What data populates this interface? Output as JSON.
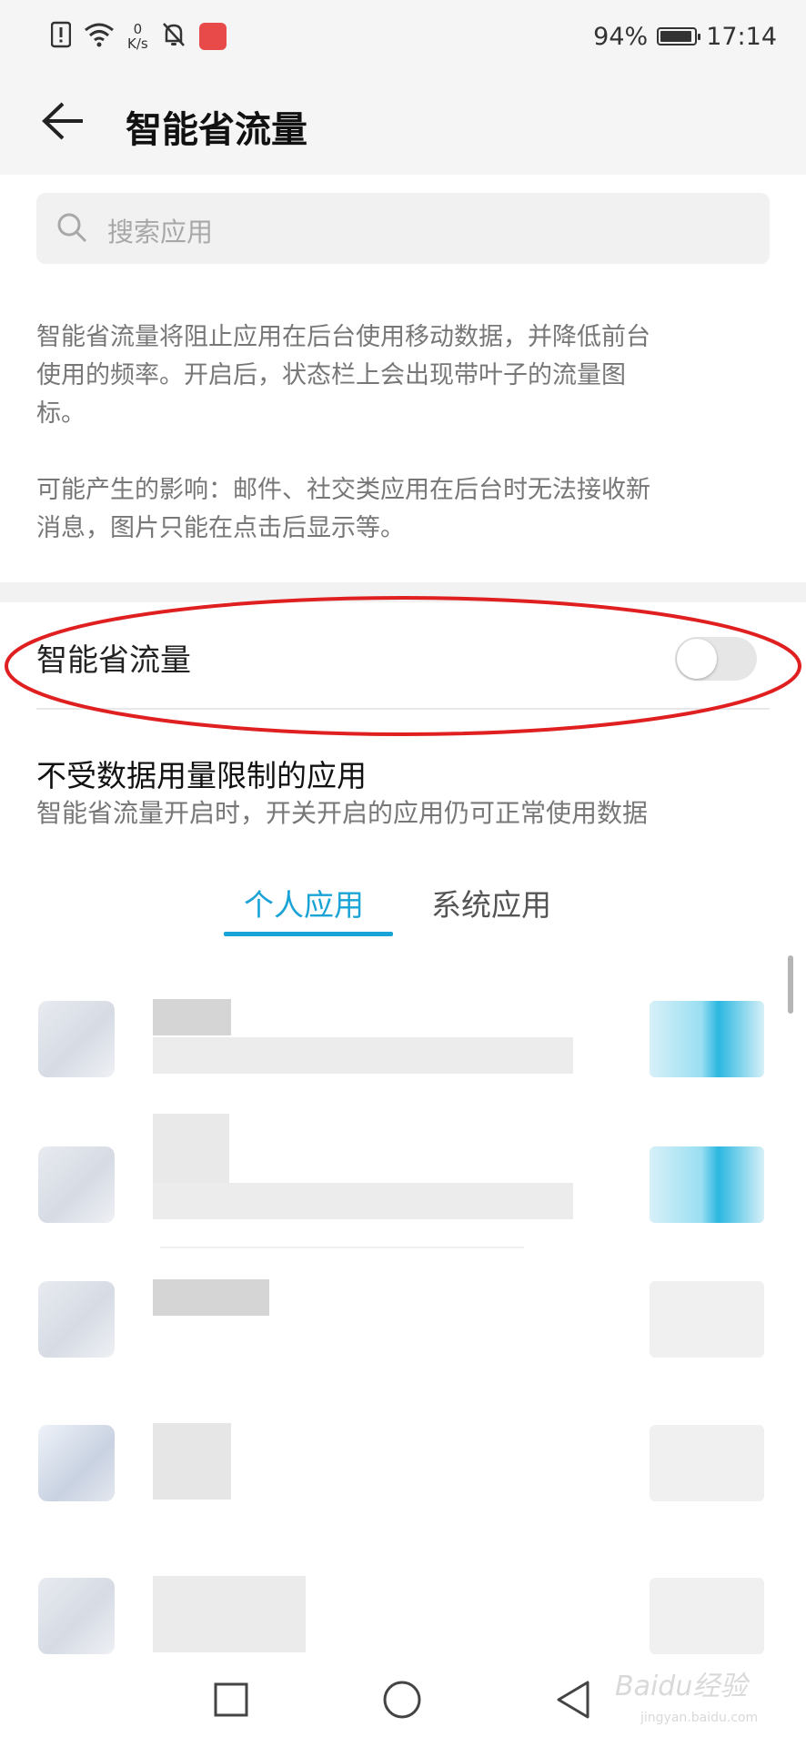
{
  "status_bar": {
    "net_speed_value": "0",
    "net_speed_unit": "K/s",
    "battery_percent": "94%",
    "battery_level": 0.94,
    "time": "17:14",
    "icons": [
      "alert-icon",
      "wifi-icon",
      "mute-bell-icon",
      "huawei-app-icon",
      "battery-icon"
    ]
  },
  "header": {
    "back_icon": "back-arrow-icon",
    "title": "智能省流量"
  },
  "search": {
    "icon": "search-icon",
    "placeholder": "搜索应用"
  },
  "description": {
    "line1": "智能省流量将阻止应用在后台使用移动数据，并降低前台",
    "line2": "使用的频率。开启后，状态栏上会出现带叶子的流量图",
    "line3": "标。",
    "impact_line1": "可能产生的影响：邮件、社交类应用在后台时无法接收新",
    "impact_line2": "消息，图片只能在点击后显示等。"
  },
  "toggle_setting": {
    "label": "智能省流量",
    "enabled": false
  },
  "unrestricted": {
    "title": "不受数据用量限制的应用",
    "subtitle": "智能省流量开启时，开关开启的应用仍可正常使用数据"
  },
  "tabs": [
    {
      "label": "个人应用",
      "active": true
    },
    {
      "label": "系统应用",
      "active": false
    }
  ],
  "accent_color": "#1aa3d6",
  "annotation_color": "#e02020",
  "app_list": [
    {
      "toggle_on": true
    },
    {
      "toggle_on": true
    },
    {
      "toggle_on": false
    },
    {
      "toggle_on": false
    },
    {
      "toggle_on": false
    }
  ],
  "nav_bar": {
    "icons": [
      "recent-apps-icon",
      "home-icon",
      "back-icon"
    ]
  },
  "watermark": {
    "text": "Baidu经验",
    "sub": "jingyan.baidu.com"
  }
}
